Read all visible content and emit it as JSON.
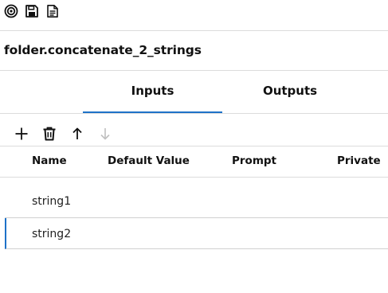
{
  "toolbar": {
    "icons": [
      "target-icon",
      "save-icon",
      "document-icon"
    ]
  },
  "flow": {
    "title": "folder.concatenate_2_strings"
  },
  "tabs": [
    {
      "label": "Inputs",
      "active": true
    },
    {
      "label": "Outputs",
      "active": false
    }
  ],
  "actions": {
    "icons": [
      "add-icon",
      "delete-icon",
      "move-up-icon",
      "move-down-icon"
    ],
    "move_down_disabled": true
  },
  "table": {
    "columns": [
      "Name",
      "Default Value",
      "Prompt",
      "Private"
    ],
    "rows": [
      {
        "name": "string1",
        "selected": false
      },
      {
        "name": "string2",
        "selected": true
      }
    ]
  },
  "colors": {
    "accent": "#1e72c8",
    "divider": "#dcdcdc",
    "disabled_icon": "#c0c0c0"
  }
}
